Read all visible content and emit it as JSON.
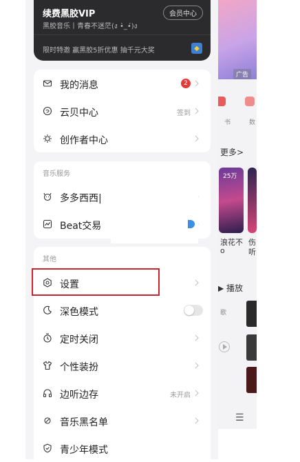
{
  "vip": {
    "title": "续费黑胶VIP",
    "button": "会员中心",
    "subtitle": "黑胶音乐丨青春不迷茫(ง •̀_•́)ง",
    "promo": "限时特邀 赢黑胶5折优惠 抽千元大奖"
  },
  "main_section": {
    "items": [
      {
        "label": "我的消息",
        "badge": "2"
      },
      {
        "label": "云贝中心",
        "right_text": "签到"
      },
      {
        "label": "创作者中心"
      }
    ]
  },
  "music_section": {
    "title": "音乐服务",
    "items": [
      {
        "label": "多多西西|"
      },
      {
        "label": "Beat交易"
      }
    ]
  },
  "other_section": {
    "title": "其他",
    "items": [
      {
        "label": "设置"
      },
      {
        "label": "深色模式",
        "toggle": false
      },
      {
        "label": "定时关闭"
      },
      {
        "label": "个性装扮"
      },
      {
        "label": "边听边存",
        "right_text": "未开启"
      },
      {
        "label": "音乐黑名单"
      },
      {
        "label": "青少年模式"
      }
    ]
  },
  "background": {
    "ad_label": "广告",
    "icon_text_1": "书",
    "icon_text_2": "数",
    "more": "更多>",
    "count": "25万",
    "song_title_1": "浪花不",
    "song_title_1b": "o",
    "song_title_2": "伤",
    "song_title_2b": "听",
    "play": "▶ 播放",
    "song_text": "歌"
  },
  "colors": {
    "accent_red": "#c7252b",
    "badge_red": "#e23b3b",
    "vip_bg": "#2b2b2e"
  },
  "icons": [
    "mail-icon",
    "cloud-coin-icon",
    "sun-bulb-icon",
    "bear-face-icon",
    "chart-icon",
    "gear-hex-icon",
    "moon-icon",
    "timer-icon",
    "tshirt-icon",
    "headphone-icon",
    "block-icon",
    "shield-icon",
    "chevron-right-icon"
  ]
}
